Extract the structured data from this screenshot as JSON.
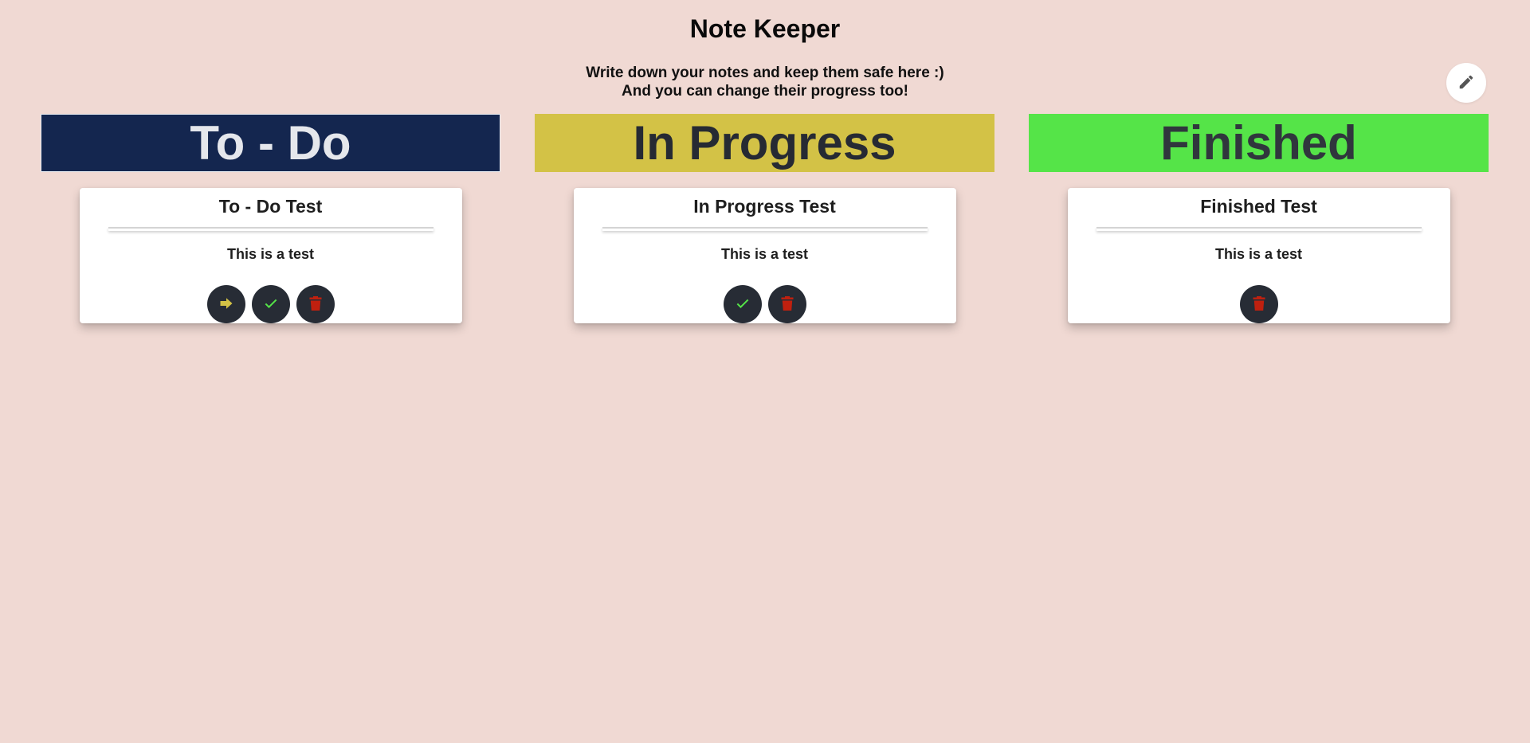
{
  "app": {
    "title": "Note Keeper",
    "subtitle_line1": "Write down your notes and keep them safe here :)",
    "subtitle_line2": "And you can change their progress too!",
    "edit_icon": "pencil-icon"
  },
  "colors": {
    "background": "#f0d9d3",
    "todo_header": "#14264f",
    "in_progress_header": "#d3c246",
    "finished_header": "#55e448",
    "action_button": "#272c35",
    "move_icon": "#d3c246",
    "check_icon": "#55e448",
    "delete_icon": "#c0200f"
  },
  "columns": [
    {
      "header": "To - Do",
      "note": {
        "title": "To - Do Test",
        "body": "This is a test",
        "actions": [
          "arrow-right-icon",
          "check-icon",
          "trash-icon"
        ]
      }
    },
    {
      "header": "In Progress",
      "note": {
        "title": "In Progress Test",
        "body": "This is a test",
        "actions": [
          "check-icon",
          "trash-icon"
        ]
      }
    },
    {
      "header": "Finished",
      "note": {
        "title": "Finished Test",
        "body": "This is a test",
        "actions": [
          "trash-icon"
        ]
      }
    }
  ]
}
